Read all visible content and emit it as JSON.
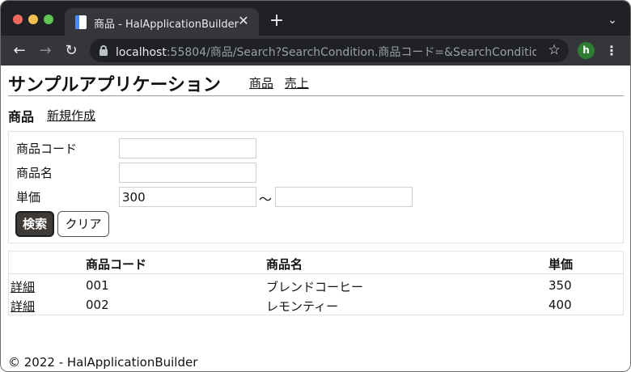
{
  "browser": {
    "tab_title": "商品 - HalApplicationBuilder",
    "tab_close_glyph": "✕",
    "new_tab_glyph": "+",
    "tab_menu_glyph": "⌄",
    "back_glyph": "←",
    "forward_glyph": "→",
    "reload_glyph": "↻",
    "url_host": "localhost",
    "url_rest": ":55804/商品/Search?SearchCondition.商品コード=&SearchCondition....",
    "star_glyph": "☆",
    "profile_initial": "h",
    "kebab_glyph": "⋮"
  },
  "app": {
    "title": "サンプルアプリケーション",
    "nav": [
      "商品",
      "売上"
    ]
  },
  "section": {
    "title": "商品",
    "new_link": "新規作成"
  },
  "search": {
    "fields": [
      {
        "label": "商品コード",
        "value": ""
      },
      {
        "label": "商品名",
        "value": ""
      },
      {
        "label": "単価",
        "value": "300",
        "value_to": ""
      }
    ],
    "range_separator": "〜",
    "search_button": "検索",
    "clear_button": "クリア"
  },
  "table": {
    "columns": [
      "",
      "商品コード",
      "商品名",
      "単価"
    ],
    "rows": [
      {
        "action": "詳細",
        "code": "001",
        "name": "ブレンドコーヒー",
        "price": "350"
      },
      {
        "action": "詳細",
        "code": "002",
        "name": "レモンティー",
        "price": "400"
      }
    ]
  },
  "footer": {
    "text": "© 2022 - HalApplicationBuilder"
  }
}
